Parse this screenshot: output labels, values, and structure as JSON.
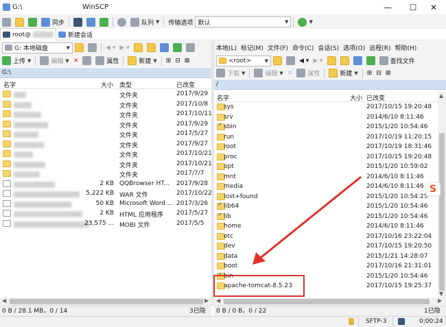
{
  "window": {
    "title_path": "G:\\",
    "app_name": "WinSCP",
    "minimize": "—",
    "maximize": "☐",
    "close": "✕"
  },
  "toolbar1": {
    "sync_label": "同步",
    "queue_label": "队列",
    "transfer_options_label": "传输选项",
    "transfer_options_value": "默认"
  },
  "session": {
    "tab_label": "root@",
    "new_session_label": "新建会话"
  },
  "menu": [
    "本地(L)",
    "标记(M)",
    "文件(F)",
    "命令(C)",
    "会话(S)",
    "选项(O)",
    "远程(R)",
    "帮助(H)"
  ],
  "left_panel": {
    "drive_label": "G: 本地磁盘",
    "upload_label": "上传",
    "edit_label": "编辑",
    "properties_label": "属性",
    "new_label": "新建",
    "path": "G:\\",
    "columns": {
      "name": "名字",
      "size": "大小",
      "type": "类型",
      "changed": "已改变"
    },
    "rows": [
      {
        "size": "",
        "type": "文件夹",
        "changed": "2017/9/29"
      },
      {
        "size": "",
        "type": "文件夹",
        "changed": "2017/10/8"
      },
      {
        "size": "",
        "type": "文件夹",
        "changed": "2017/10/11"
      },
      {
        "size": "",
        "type": "文件夹",
        "changed": "2017/9/29"
      },
      {
        "size": "",
        "type": "文件夹",
        "changed": "2017/5/27"
      },
      {
        "size": "",
        "type": "文件夹",
        "changed": "2017/9/27"
      },
      {
        "size": "",
        "type": "文件夹",
        "changed": "2017/10/21"
      },
      {
        "size": "",
        "type": "文件夹",
        "changed": "2017/10/21"
      },
      {
        "size": "",
        "type": "文件夹",
        "changed": "2017/7/7"
      },
      {
        "size": "2 KB",
        "type": "QQBrowser HT...",
        "changed": "2017/9/28"
      },
      {
        "size": "5,222 KB",
        "type": "WAR 文件",
        "changed": "2017/10/22"
      },
      {
        "size": "50 KB",
        "type": "Microsoft Word ...",
        "changed": "2017/3/26"
      },
      {
        "size": "2 KB",
        "type": "HTML 应用程序",
        "changed": "2017/5/27"
      },
      {
        "size": "23,575 ...",
        "type": "MOBI 文件",
        "changed": "2017/5/5"
      }
    ],
    "status": "0 B / 28.1 MB，0 / 14",
    "hidden": "3已隐藏"
  },
  "right_panel": {
    "path_label": "<root>",
    "download_label": "下载",
    "edit_label": "编辑",
    "properties_label": "属性",
    "new_label": "新建",
    "find_label": "查找文件",
    "path": "/",
    "columns": {
      "name": "名字",
      "size": "大小",
      "changed": "已改变"
    },
    "rows": [
      {
        "name": "sys",
        "changed": "2017/10/15 19:20:48",
        "link": false
      },
      {
        "name": "srv",
        "changed": "2014/6/10 8:11:46",
        "link": false
      },
      {
        "name": "sbin",
        "changed": "2015/1/20 10:54:46",
        "link": true
      },
      {
        "name": "run",
        "changed": "2017/10/19 11:20:15",
        "link": false
      },
      {
        "name": "root",
        "changed": "2017/10/19 18:31:46",
        "link": false
      },
      {
        "name": "proc",
        "changed": "2017/10/15 19:20:48",
        "link": false
      },
      {
        "name": "opt",
        "changed": "2015/1/20 10:59:02",
        "link": false
      },
      {
        "name": "mnt",
        "changed": "2014/6/10 8:11:46",
        "link": false
      },
      {
        "name": "media",
        "changed": "2014/6/10 8:11:46",
        "link": false
      },
      {
        "name": "lost+found",
        "changed": "2015/1/20 10:54:25",
        "link": false
      },
      {
        "name": "lib64",
        "changed": "2015/1/20 10:54:46",
        "link": true
      },
      {
        "name": "lib",
        "changed": "2015/1/20 10:54:46",
        "link": true
      },
      {
        "name": "home",
        "changed": "2014/6/10 8:11:46",
        "link": false
      },
      {
        "name": "etc",
        "changed": "2017/10/16 23:22:04",
        "link": false
      },
      {
        "name": "dev",
        "changed": "2017/10/15 19:20:50",
        "link": false
      },
      {
        "name": "data",
        "changed": "2015/1/21 14:28:07",
        "link": false
      },
      {
        "name": "boot",
        "changed": "2017/10/16 21:31:01",
        "link": false
      },
      {
        "name": "bin",
        "changed": "2015/1/20 10:54:46",
        "link": true
      },
      {
        "name": "apache-tomcat-8.5.23",
        "changed": "2017/10/15 19:25:37",
        "link": false
      }
    ],
    "status": "0 B / 0 B，0 / 22",
    "hidden": "1已隐藏"
  },
  "bottom": {
    "protocol": "SFTP-3",
    "elapsed": "0:00:24"
  },
  "colors": {
    "highlight_box": "#d9342b",
    "arrow": "#e0322b",
    "path_bar": "#cfe0f3"
  }
}
